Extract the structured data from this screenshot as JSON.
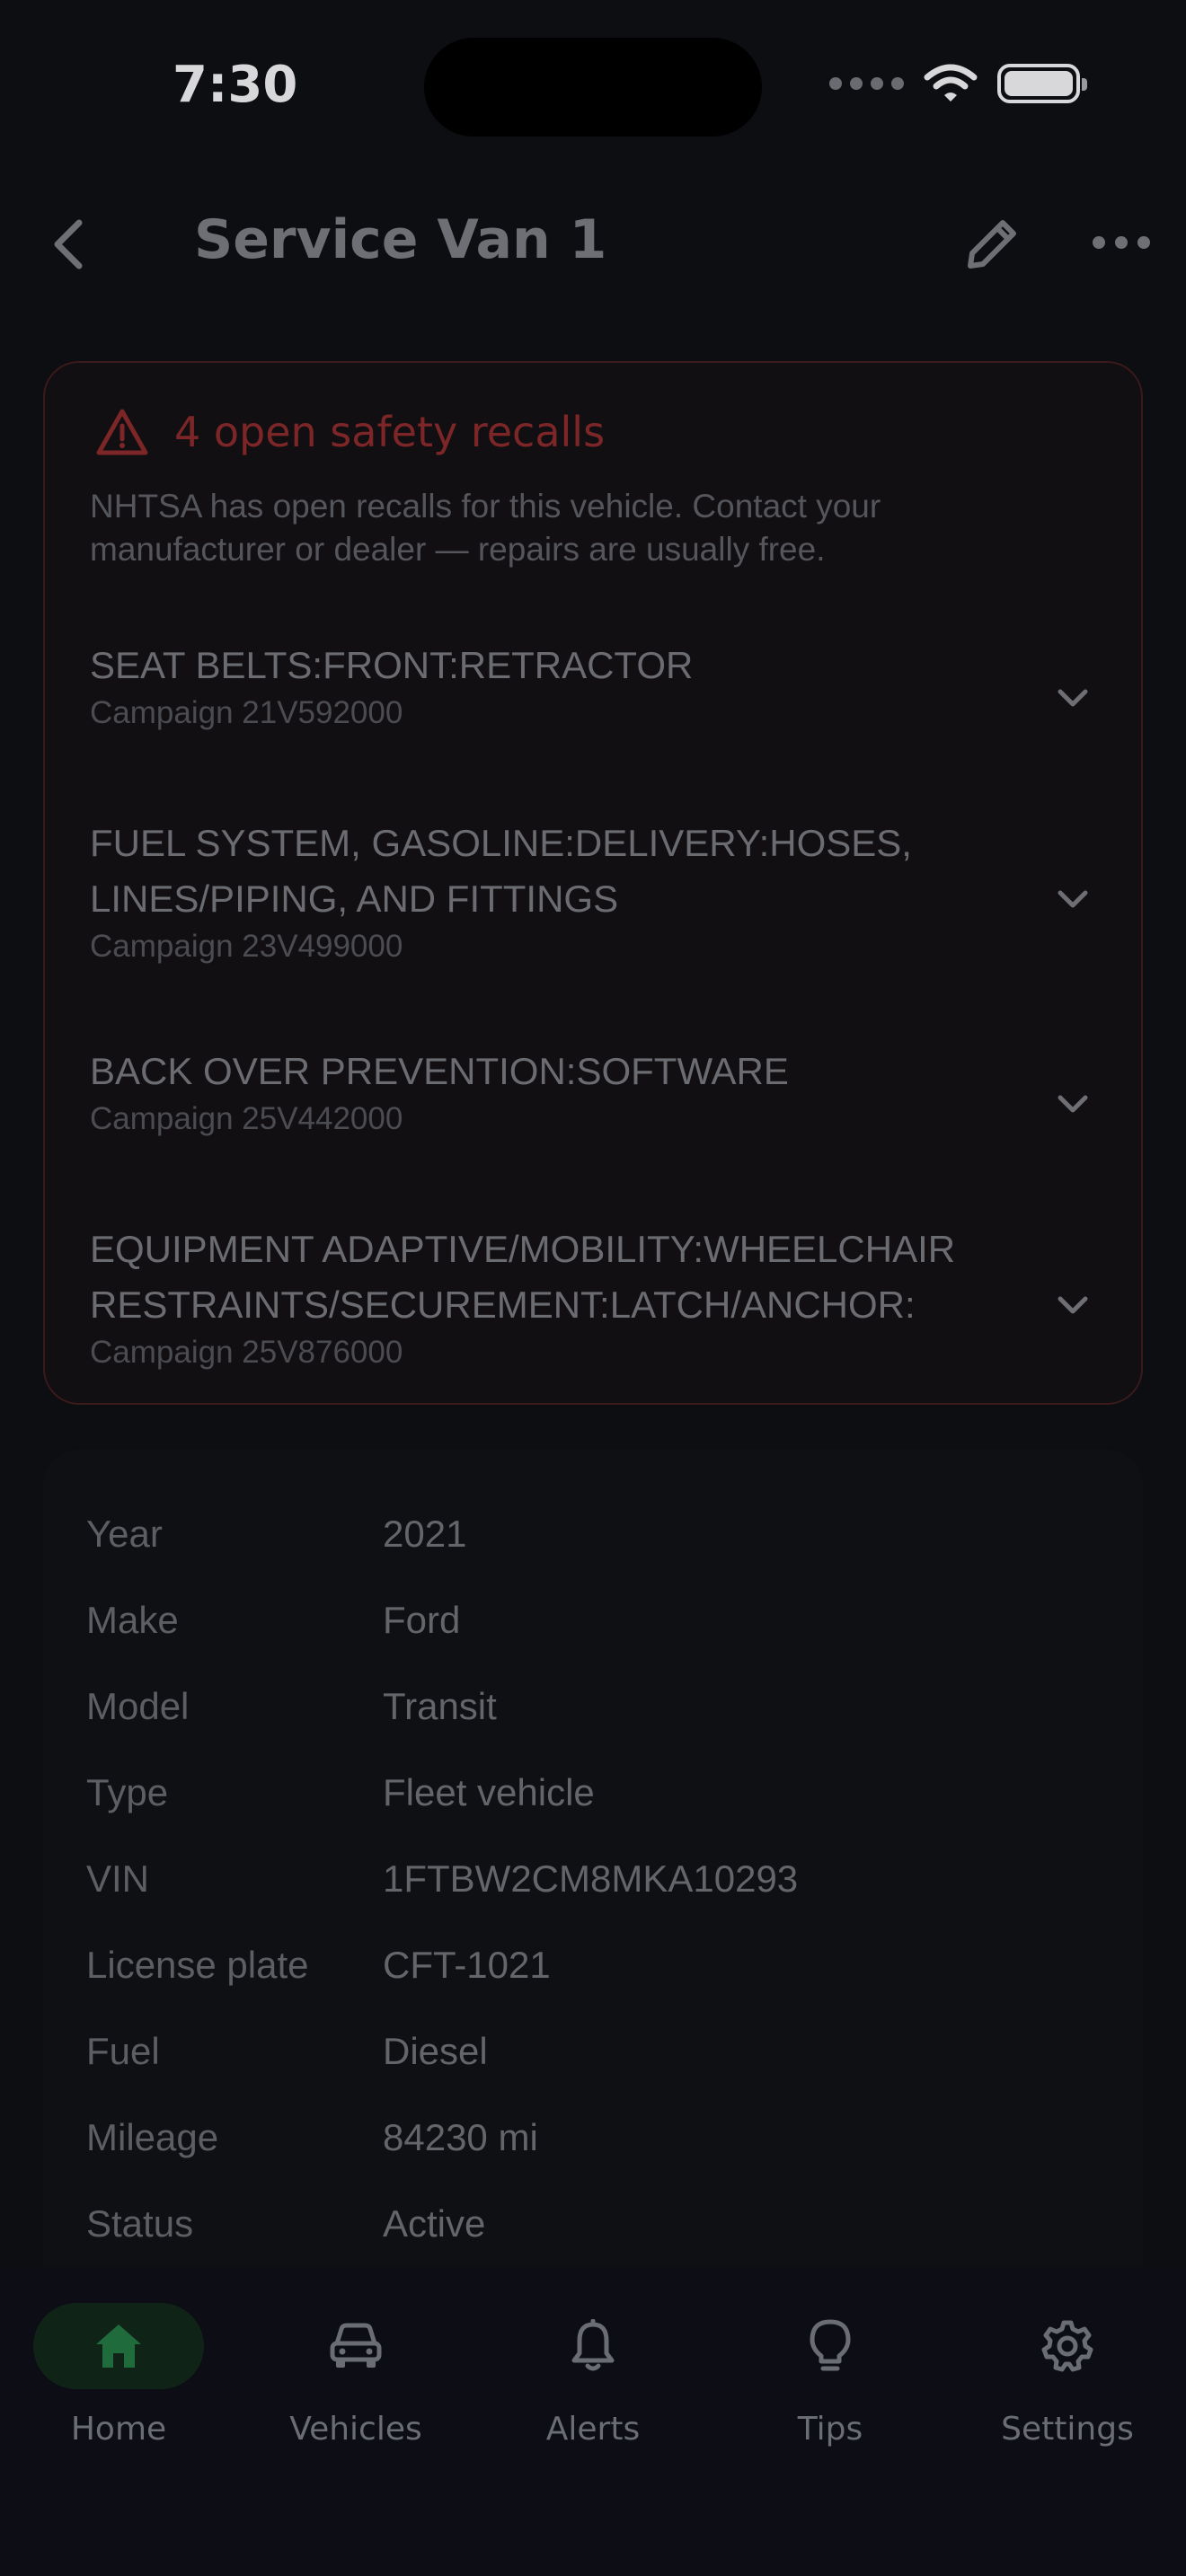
{
  "status_bar": {
    "time": "7:30"
  },
  "header": {
    "title": "Service Van 1"
  },
  "recalls": {
    "title": "4 open safety recalls",
    "description": "NHTSA has open recalls for this vehicle. Contact your manufacturer or dealer — repairs are usually free.",
    "items": [
      {
        "name": "SEAT BELTS:FRONT:RETRACTOR",
        "campaign": "Campaign 21V592000"
      },
      {
        "name": "FUEL SYSTEM, GASOLINE:DELIVERY:HOSES, LINES/PIPING, AND FITTINGS",
        "campaign": "Campaign 23V499000"
      },
      {
        "name": "BACK OVER PREVENTION:SOFTWARE",
        "campaign": "Campaign 25V442000"
      },
      {
        "name": "EQUIPMENT ADAPTIVE/MOBILITY:WHEELCHAIR RESTRAINTS/SECUREMENT:LATCH/ANCHOR:",
        "campaign": "Campaign 25V876000"
      }
    ]
  },
  "details": [
    {
      "label": "Year",
      "value": "2021"
    },
    {
      "label": "Make",
      "value": "Ford"
    },
    {
      "label": "Model",
      "value": "Transit"
    },
    {
      "label": "Type",
      "value": "Fleet vehicle"
    },
    {
      "label": "VIN",
      "value": "1FTBW2CM8MKA10293"
    },
    {
      "label": "License plate",
      "value": "CFT-1021"
    },
    {
      "label": "Fuel",
      "value": "Diesel"
    },
    {
      "label": "Mileage",
      "value": "84230 mi"
    },
    {
      "label": "Status",
      "value": "Active"
    }
  ],
  "nav": [
    {
      "label": "Home",
      "icon": "home-icon",
      "active": true
    },
    {
      "label": "Vehicles",
      "icon": "car-icon",
      "active": false
    },
    {
      "label": "Alerts",
      "icon": "bell-icon",
      "active": false
    },
    {
      "label": "Tips",
      "icon": "lightbulb-icon",
      "active": false
    },
    {
      "label": "Settings",
      "icon": "gear-icon",
      "active": false
    }
  ],
  "colors": {
    "accent": "#1f6b3c",
    "warning": "#7d2628",
    "background": "#0d0e11"
  }
}
